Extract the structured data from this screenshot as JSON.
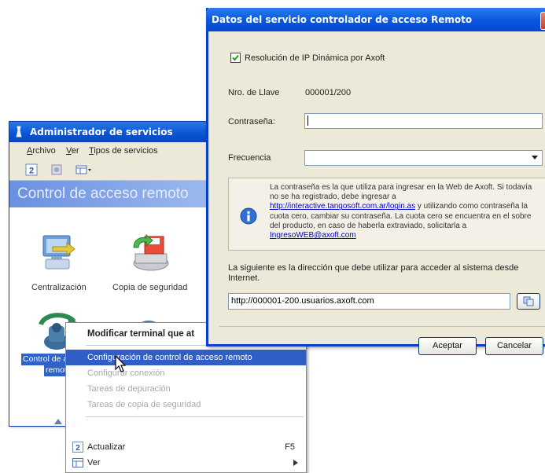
{
  "admin": {
    "title": "Administrador de servicios",
    "menu": {
      "archivo": "rchivo",
      "archivo_key": "A",
      "ver": "er",
      "ver_key": "V",
      "tipos": "ipos de servicios",
      "tipos_key": "T"
    },
    "banner": "Control de acceso remoto",
    "services": [
      {
        "label": "Centralización",
        "icon": "centralization-icon"
      },
      {
        "label": "Copia de seguridad",
        "icon": "backup-icon"
      },
      {
        "label": "Control de a",
        "label2": "remot",
        "icon": "remote-access-icon",
        "selected": true
      },
      {
        "label": "",
        "icon": "globe-icon"
      }
    ]
  },
  "context_menu": {
    "items": [
      {
        "label": "Modificar terminal que at",
        "style": "bold"
      },
      {
        "label": "Configuración de control de acceso remoto",
        "style": "highlighted"
      },
      {
        "label": "Configurar conexión",
        "style": "disabled"
      },
      {
        "label": "Tareas de depuración",
        "style": "disabled"
      },
      {
        "label": "Tareas de copia de seguridad",
        "style": "disabled"
      },
      {
        "label": "Actualizar",
        "shortcut": "F5",
        "icon": "refresh-icon"
      },
      {
        "label": "Ver",
        "submenu": true,
        "icon": "view-icon"
      }
    ]
  },
  "dialog": {
    "title": "Datos del servicio controlador de acceso Remoto",
    "checkbox_label": "Resolución de IP Dinámica por Axoft",
    "checkbox_checked": true,
    "key_label": "Nro. de Llave",
    "key_value": "000001/200",
    "password_label": "Contraseña:",
    "password_value": "",
    "frequency_label": "Frecuencia",
    "frequency_value": "",
    "info_text_1": "La contraseña es la que utiliza para ingresar en la Web de Axoft. Si todavía no se ha registrado, debe ingresar a ",
    "info_link_1": "http://interactive.tangosoft.com.ar/login.as",
    "info_text_2": " y utilizando como contraseña la cuota cero, cambiar su contraseña. La cuota cero se encuentra en el sobre del producto, en caso de haberla extraviado, solicitarla a ",
    "info_link_2": "IngresoWEB@axoft.com",
    "url_note": "La siguiente es la dirección que debe utilizar para acceder al sistema desde Internet.",
    "url_value": "http://000001-200.usuarios.axoft.com",
    "ok_label": "Aceptar",
    "cancel_label": "Cancelar"
  }
}
